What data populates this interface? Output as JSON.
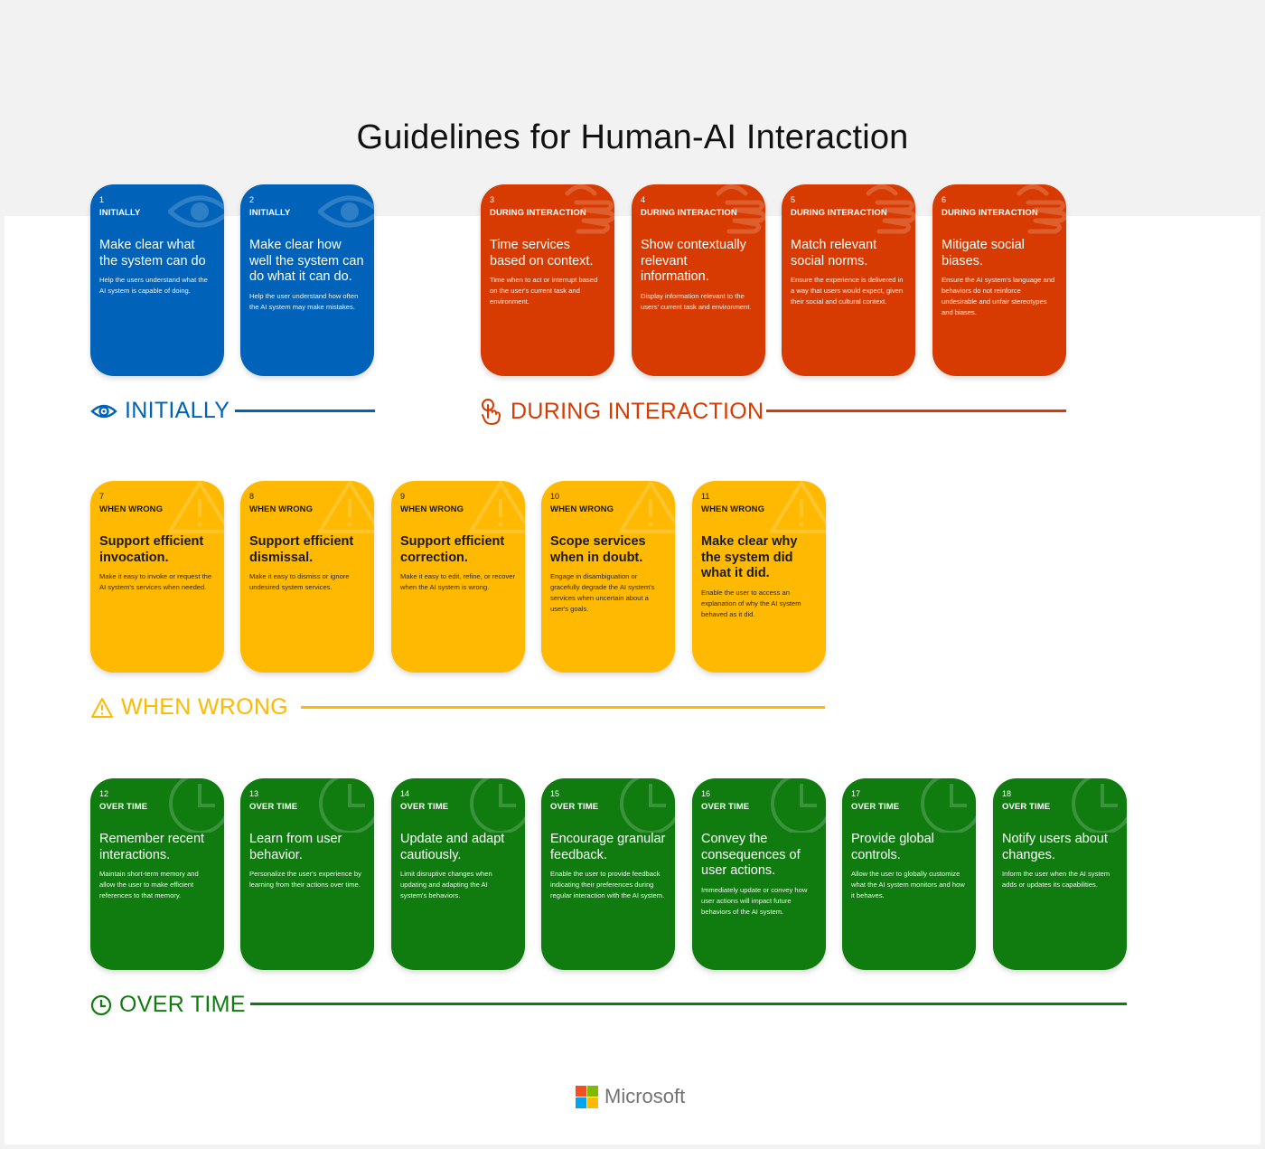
{
  "title": "Guidelines for Human-AI Interaction",
  "colors": {
    "initially": "#0063b9",
    "during_interaction": "#d83b01",
    "when_wrong": "#ffb900",
    "over_time": "#107c10",
    "background": "#f2f2f2"
  },
  "sections": {
    "initially": {
      "label": "INITIALLY",
      "icon": "eye-icon"
    },
    "during_interaction": {
      "label": "DURING INTERACTION",
      "icon": "touch-hand-icon"
    },
    "when_wrong": {
      "label": "WHEN WRONG",
      "icon": "warning-icon"
    },
    "over_time": {
      "label": "OVER TIME",
      "icon": "clock-icon"
    }
  },
  "cards": [
    {
      "num": "1",
      "category": "INITIALLY",
      "heading": "Make clear what the system can do",
      "description": "Help the users understand what the AI system is capable of doing."
    },
    {
      "num": "2",
      "category": "INITIALLY",
      "heading": "Make clear how well the system can do what it can do.",
      "description": "Help the user understand how often the AI system may make mistakes."
    },
    {
      "num": "3",
      "category": "DURING INTERACTION",
      "heading": "Time services based on context.",
      "description": "Time when to act or interrupt based on the user's current task and environment."
    },
    {
      "num": "4",
      "category": "DURING INTERACTION",
      "heading": "Show contextually relevant information.",
      "description": "Display information relevant to the users' current task and environment."
    },
    {
      "num": "5",
      "category": "DURING INTERACTION",
      "heading": "Match relevant social norms.",
      "description": "Ensure the experience is delivered in a way that users would expect, given their social and cultural context."
    },
    {
      "num": "6",
      "category": "DURING INTERACTION",
      "heading": "Mitigate social biases.",
      "description": "Ensure the AI system's language and behaviors do not reinforce undesirable and unfair stereotypes and biases."
    },
    {
      "num": "7",
      "category": "WHEN WRONG",
      "heading": "Support efficient invocation.",
      "description": "Make it easy to invoke or request the AI system's services when needed."
    },
    {
      "num": "8",
      "category": "WHEN WRONG",
      "heading": "Support efficient dismissal.",
      "description": "Make it easy to dismiss or ignore undesired system services."
    },
    {
      "num": "9",
      "category": "WHEN WRONG",
      "heading": "Support efficient correction.",
      "description": "Make it easy to edit, refine, or recover when the AI system is wrong."
    },
    {
      "num": "10",
      "category": "WHEN WRONG",
      "heading": "Scope services when in doubt.",
      "description": "Engage in disambiguation or gracefully degrade the AI system's services when uncertain about a user's goals."
    },
    {
      "num": "11",
      "category": "WHEN WRONG",
      "heading": "Make clear why the system did what it did.",
      "description": "Enable the user to access an explanation of why the AI system behaved as it did."
    },
    {
      "num": "12",
      "category": "OVER TIME",
      "heading": "Remember recent interactions.",
      "description": "Maintain short-term memory and allow the user to make efficient references to that memory."
    },
    {
      "num": "13",
      "category": "OVER TIME",
      "heading": "Learn from user behavior.",
      "description": "Personalize the user's experience by learning from their actions over time."
    },
    {
      "num": "14",
      "category": "OVER TIME",
      "heading": "Update and adapt cautiously.",
      "description": "Limit disruptive changes when updating and adapting the AI system's behaviors."
    },
    {
      "num": "15",
      "category": "OVER TIME",
      "heading": "Encourage granular feedback.",
      "description": "Enable the user to provide feedback indicating their preferences during regular interaction with the AI system."
    },
    {
      "num": "16",
      "category": "OVER TIME",
      "heading": "Convey the consequences of user actions.",
      "description": "Immediately update or convey how user actions will impact future behaviors of the AI system."
    },
    {
      "num": "17",
      "category": "OVER TIME",
      "heading": "Provide global controls.",
      "description": "Allow the user to globally customize what the AI system monitors and how it behaves."
    },
    {
      "num": "18",
      "category": "OVER TIME",
      "heading": "Notify users about changes.",
      "description": "Inform the user when the AI system adds or updates its capabilities."
    }
  ],
  "footer": {
    "brand": "Microsoft",
    "logo_colors": [
      "#f25022",
      "#7fba00",
      "#00a4ef",
      "#ffb900"
    ]
  }
}
